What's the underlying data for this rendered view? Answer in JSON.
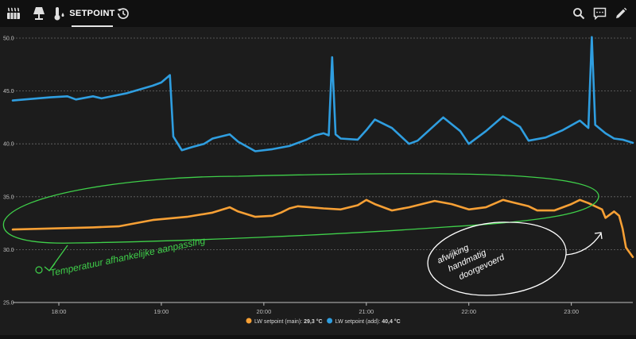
{
  "toolbar": {
    "tabs": [
      {
        "icon": "radiator-icon"
      },
      {
        "icon": "lamp-icon"
      },
      {
        "icon": "thermometer-drop-icon"
      },
      {
        "label": "SETPOINT",
        "active": true
      },
      {
        "icon": "history-icon"
      }
    ],
    "actions": [
      "search-icon",
      "comment-icon",
      "edit-icon"
    ]
  },
  "colors": {
    "main": "#f7a035",
    "add": "#2f9ee0",
    "annotation_green": "#3fd04a",
    "annotation_white": "#ffffff"
  },
  "chart_data": {
    "type": "line",
    "x_ticks": [
      "18:00",
      "19:00",
      "20:00",
      "21:00",
      "22:00",
      "23:00"
    ],
    "y_ticks": [
      "25.0",
      "30.0",
      "35.0",
      "40.0",
      "45.0",
      "50.0"
    ],
    "ylim": [
      25,
      50
    ],
    "xlim": [
      "17:33",
      "23:36"
    ],
    "grid": "horizontal dashed",
    "legend_position": "bottom-center",
    "series": [
      {
        "name": "LW setpoint (main)",
        "current": "29,3 °C",
        "color": "#f7a035",
        "points": [
          [
            "17:33",
            31.9
          ],
          [
            "18:20",
            32.1
          ],
          [
            "18:35",
            32.2
          ],
          [
            "18:55",
            32.8
          ],
          [
            "19:15",
            33.1
          ],
          [
            "19:30",
            33.5
          ],
          [
            "19:40",
            34.0
          ],
          [
            "19:45",
            33.6
          ],
          [
            "19:55",
            33.1
          ],
          [
            "20:05",
            33.2
          ],
          [
            "20:10",
            33.5
          ],
          [
            "20:15",
            33.9
          ],
          [
            "20:20",
            34.1
          ],
          [
            "20:35",
            33.9
          ],
          [
            "20:45",
            33.8
          ],
          [
            "20:55",
            34.2
          ],
          [
            "21:00",
            34.7
          ],
          [
            "21:05",
            34.3
          ],
          [
            "21:15",
            33.7
          ],
          [
            "21:25",
            34.0
          ],
          [
            "21:35",
            34.4
          ],
          [
            "21:40",
            34.6
          ],
          [
            "21:50",
            34.3
          ],
          [
            "22:00",
            33.8
          ],
          [
            "22:10",
            34.0
          ],
          [
            "22:20",
            34.7
          ],
          [
            "22:25",
            34.5
          ],
          [
            "22:35",
            34.1
          ],
          [
            "22:40",
            33.7
          ],
          [
            "22:50",
            33.7
          ],
          [
            "23:00",
            34.3
          ],
          [
            "23:05",
            34.7
          ],
          [
            "23:10",
            34.4
          ],
          [
            "23:18",
            33.8
          ],
          [
            "23:20",
            33.0
          ],
          [
            "23:25",
            33.6
          ],
          [
            "23:28",
            33.2
          ],
          [
            "23:30",
            32.0
          ],
          [
            "23:32",
            30.2
          ],
          [
            "23:36",
            29.3
          ]
        ]
      },
      {
        "name": "LW setpoint (add)",
        "current": "40,4 °C",
        "color": "#2f9ee0",
        "points": [
          [
            "17:33",
            44.1
          ],
          [
            "17:55",
            44.4
          ],
          [
            "18:05",
            44.5
          ],
          [
            "18:10",
            44.2
          ],
          [
            "18:20",
            44.5
          ],
          [
            "18:25",
            44.3
          ],
          [
            "18:40",
            44.8
          ],
          [
            "18:55",
            45.5
          ],
          [
            "19:00",
            45.8
          ],
          [
            "19:05",
            46.5
          ],
          [
            "19:07",
            40.7
          ],
          [
            "19:12",
            39.4
          ],
          [
            "19:18",
            39.7
          ],
          [
            "19:25",
            40.0
          ],
          [
            "19:30",
            40.5
          ],
          [
            "19:40",
            40.9
          ],
          [
            "19:45",
            40.2
          ],
          [
            "19:55",
            39.3
          ],
          [
            "20:05",
            39.5
          ],
          [
            "20:15",
            39.8
          ],
          [
            "20:25",
            40.4
          ],
          [
            "20:30",
            40.8
          ],
          [
            "20:35",
            41.0
          ],
          [
            "20:38",
            40.8
          ],
          [
            "20:40",
            48.2
          ],
          [
            "20:42",
            40.9
          ],
          [
            "20:45",
            40.5
          ],
          [
            "20:55",
            40.4
          ],
          [
            "21:00",
            41.3
          ],
          [
            "21:05",
            42.3
          ],
          [
            "21:15",
            41.5
          ],
          [
            "21:25",
            40.0
          ],
          [
            "21:30",
            40.3
          ],
          [
            "21:45",
            42.5
          ],
          [
            "21:55",
            41.2
          ],
          [
            "22:00",
            40.0
          ],
          [
            "22:10",
            41.2
          ],
          [
            "22:20",
            42.6
          ],
          [
            "22:30",
            41.6
          ],
          [
            "22:35",
            40.3
          ],
          [
            "22:45",
            40.6
          ],
          [
            "22:55",
            41.3
          ],
          [
            "23:05",
            42.2
          ],
          [
            "23:10",
            41.5
          ],
          [
            "23:12",
            50.1
          ],
          [
            "23:14",
            41.8
          ],
          [
            "23:20",
            41.0
          ],
          [
            "23:25",
            40.5
          ],
          [
            "23:30",
            40.4
          ],
          [
            "23:36",
            40.1
          ]
        ]
      }
    ],
    "annotations": [
      {
        "text": "Temperatuur afhankelijke aanpassing",
        "color": "green"
      },
      {
        "text": "afwijking handmatig doorgevoerd",
        "color": "white"
      }
    ]
  }
}
